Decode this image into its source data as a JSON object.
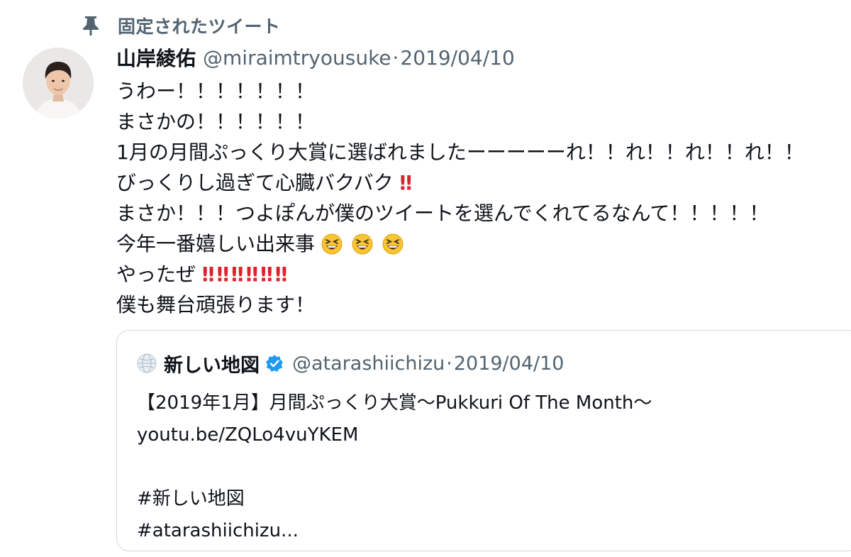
{
  "pinned": {
    "label": "固定されたツイート",
    "icon": "pin-icon"
  },
  "tweet": {
    "display_name": "山岸綾佑",
    "handle": "@miraimtryousuke",
    "separator": "·",
    "date": "2019/04/10",
    "lines": {
      "l1": "うわー！！！！！！！",
      "l2": "まさかの！！！！！！",
      "l3": "1月の月間ぷっくり大賞に選ばれましたーーーーーれ！！れ！！れ！！れ！！",
      "l4": "びっくりし過ぎて心臓バクバク",
      "l5": "まさか！！！つよぽんが僕のツイートを選んでくれてるなんて！！！！！",
      "l6": "今年一番嬉しい出来事",
      "l7": "やったぜ",
      "l8": "僕も舞台頑張ります！"
    },
    "emoji": {
      "double_exclamation": "‼",
      "grinning_squinting": "grinning-squinting-face-icon"
    }
  },
  "quoted": {
    "display_name": "新しい地図",
    "verified": true,
    "handle": "@atarashiichizu",
    "separator": "·",
    "date": "2019/04/10",
    "lines": {
      "l1": "【2019年1月】月間ぷっくり大賞〜Pukkuri Of The Month〜",
      "l2": "youtu.be/ZQLo4vuYKEM",
      "l3": "#新しい地図",
      "l4": "#atarashiichizu..."
    }
  },
  "colors": {
    "text": "#0f1419",
    "secondary": "#536471",
    "border": "#cfd9de",
    "verified": "#1d9bf0",
    "bang_red": "#e0202a",
    "emoji_yellow": "#f7c531"
  }
}
